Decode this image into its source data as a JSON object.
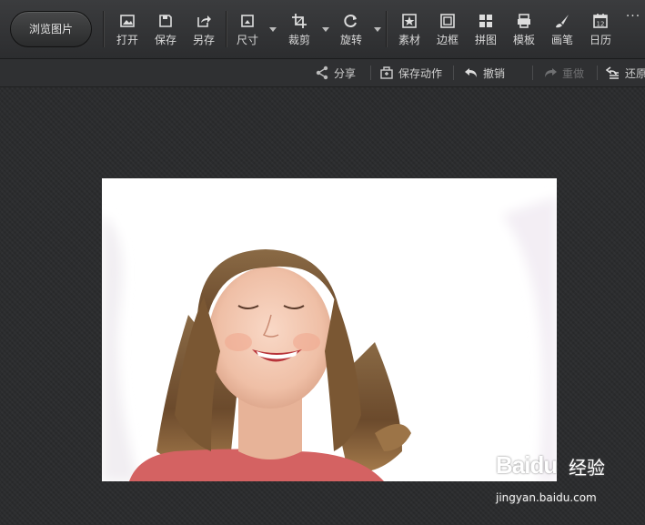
{
  "toolbar": {
    "browse_label": "浏览图片",
    "tools": [
      {
        "label": "打开",
        "icon": "open-image-icon"
      },
      {
        "label": "保存",
        "icon": "save-icon"
      },
      {
        "label": "另存",
        "icon": "save-as-icon"
      },
      {
        "label": "尺寸",
        "icon": "resize-icon"
      },
      {
        "label": "裁剪",
        "icon": "crop-icon"
      },
      {
        "label": "旋转",
        "icon": "rotate-icon"
      },
      {
        "label": "素材",
        "icon": "star-icon"
      },
      {
        "label": "边框",
        "icon": "frame-icon"
      },
      {
        "label": "拼图",
        "icon": "grid-icon"
      },
      {
        "label": "模板",
        "icon": "template-icon"
      },
      {
        "label": "画笔",
        "icon": "brush-icon"
      },
      {
        "label": "日历",
        "icon": "calendar-icon"
      }
    ],
    "more": "···",
    "calendar_day": "12"
  },
  "subbar": {
    "share": "分享",
    "save_action": "保存动作",
    "undo": "撤销",
    "redo": "重做",
    "restore": "还原"
  },
  "watermark": {
    "logo_text": "Baidu",
    "logo_suffix": "经验",
    "url": "jingyan.baidu.com"
  }
}
